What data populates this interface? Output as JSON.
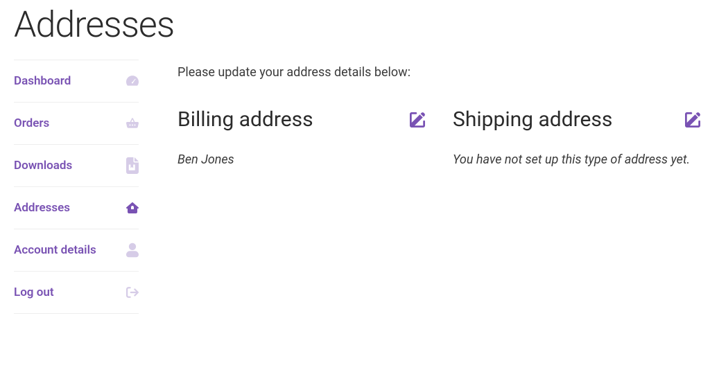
{
  "page": {
    "title": "Addresses"
  },
  "sidebar": {
    "items": [
      {
        "label": "Dashboard",
        "icon": "dashboard-icon",
        "active": false
      },
      {
        "label": "Orders",
        "icon": "basket-icon",
        "active": false
      },
      {
        "label": "Downloads",
        "icon": "file-icon",
        "active": false
      },
      {
        "label": "Addresses",
        "icon": "home-icon",
        "active": true
      },
      {
        "label": "Account details",
        "icon": "user-icon",
        "active": false
      },
      {
        "label": "Log out",
        "icon": "logout-icon",
        "active": false
      }
    ]
  },
  "main": {
    "intro": "Please update your address details below:",
    "billing": {
      "heading": "Billing address",
      "body": "Ben Jones"
    },
    "shipping": {
      "heading": "Shipping address",
      "body": "You have not set up this type of address yet."
    }
  }
}
